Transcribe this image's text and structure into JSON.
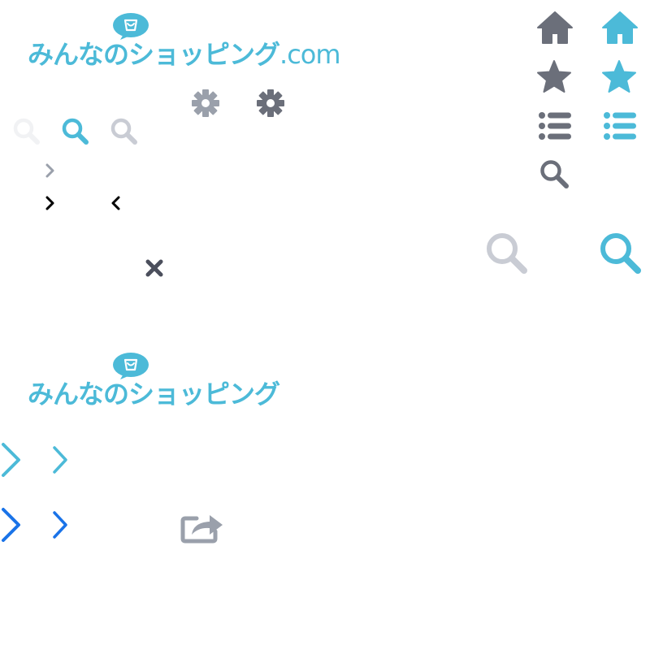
{
  "logo_top": {
    "name": "みんなのショッピング",
    "domain": ".com"
  },
  "logo_bottom": {
    "name": "みんなのショッピング"
  },
  "colors": {
    "brand_blue": "#4cbad8",
    "gray": "#6b6f7a",
    "light_gray": "#c9ccd4",
    "very_light_gray": "#f1f2f4",
    "dark_gray": "#4b4f5c",
    "black": "#000000",
    "bright_blue": "#1a73e8",
    "medium_gray": "#9aa0ab"
  },
  "icons": [
    "home-icon",
    "star-icon",
    "list-icon",
    "search-icon",
    "gear-icon",
    "chevron-right-icon",
    "chevron-left-icon",
    "close-icon",
    "share-icon",
    "shopping-bag-icon"
  ]
}
